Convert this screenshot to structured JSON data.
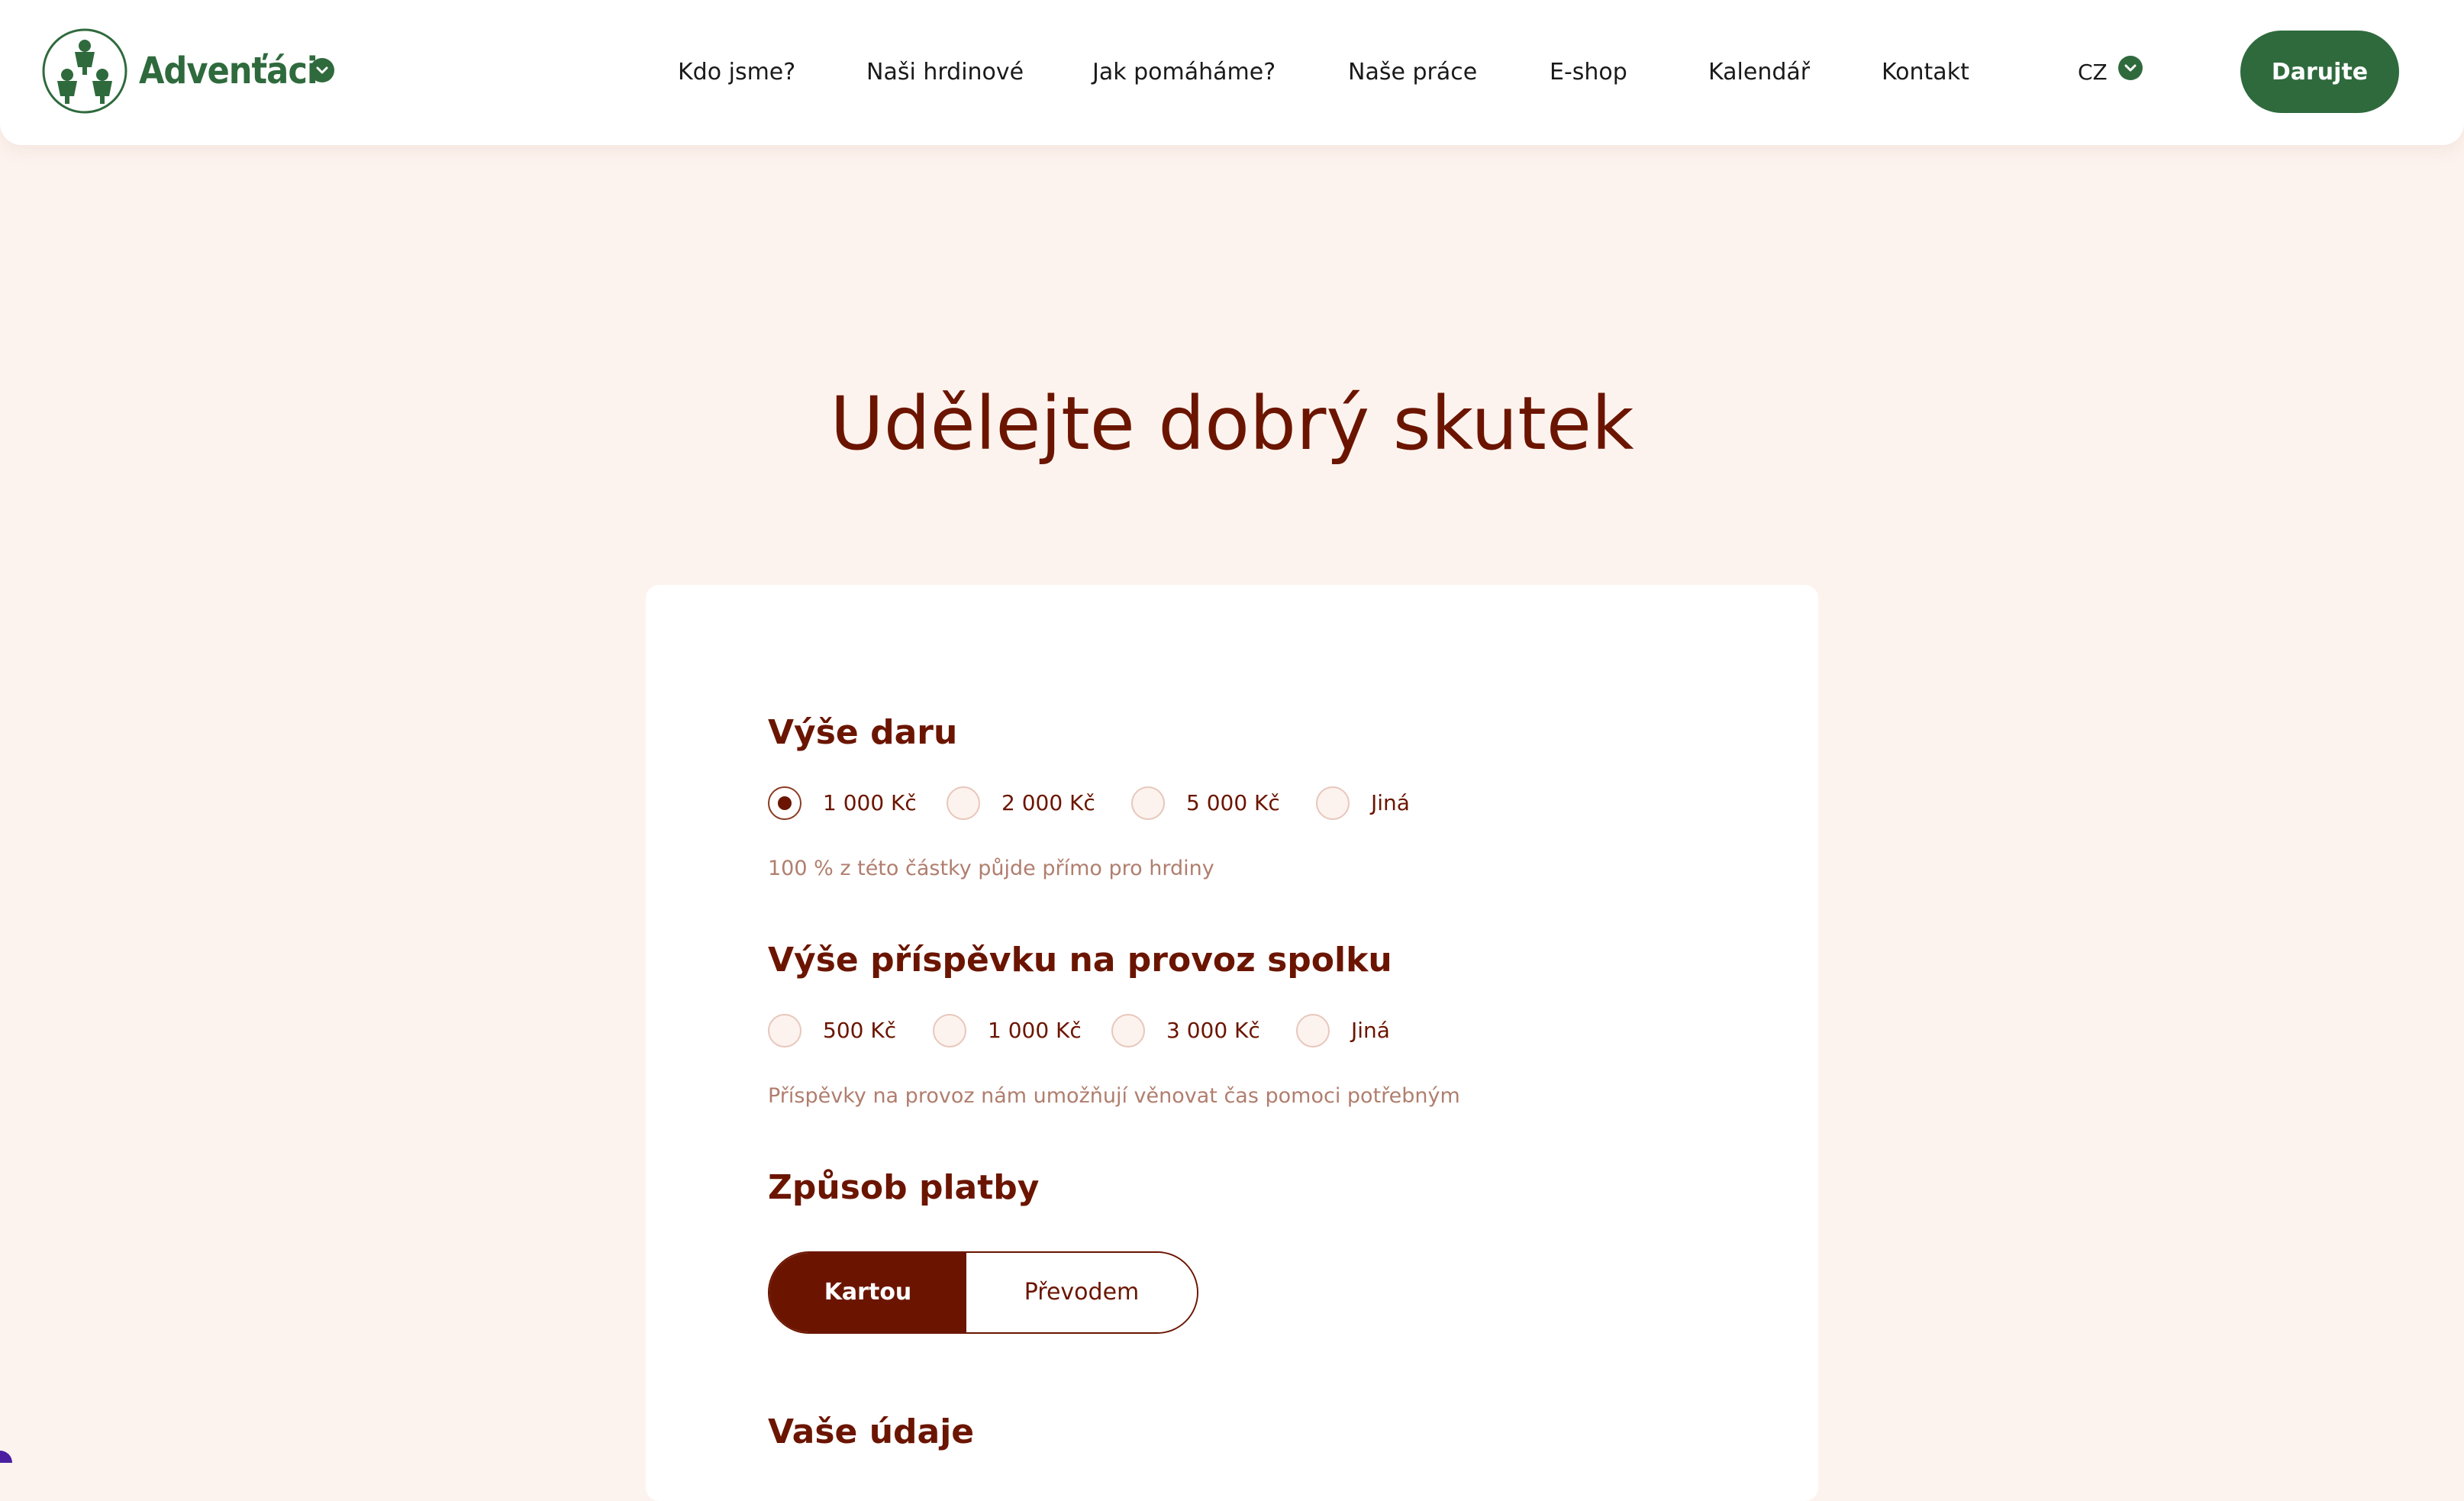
{
  "brand": {
    "name": "Advenťáci"
  },
  "nav": {
    "items": [
      "Kdo jsme?",
      "Naši hrdinové",
      "Jak pomáháme?",
      "Naše práce",
      "E-shop",
      "Kalendář",
      "Kontakt"
    ],
    "language": "CZ",
    "donate_label": "Darujte"
  },
  "page": {
    "title": "Udělejte dobrý skutek"
  },
  "donation": {
    "title": "Výše daru",
    "options": [
      "1 000 Kč",
      "2 000 Kč",
      "5 000 Kč",
      "Jiná"
    ],
    "selected": "1 000 Kč",
    "hint": "100 % z této částky půjde přímo pro hrdiny"
  },
  "contribution": {
    "title": "Výše příspěvku na provoz spolku",
    "options": [
      "500 Kč",
      "1 000 Kč",
      "3 000 Kč",
      "Jiná"
    ],
    "selected": null,
    "hint": "Příspěvky na provoz nám umožňují věnovat čas pomoci potřebným"
  },
  "payment": {
    "title": "Způsob platby",
    "options": [
      "Kartou",
      "Převodem"
    ],
    "selected": "Kartou"
  },
  "details": {
    "title": "Vaše údaje"
  },
  "colors": {
    "primary_green": "#2f6a3d",
    "accent_brown": "#6b1500",
    "page_bg": "#fdf3ee",
    "hint_text": "#b07e6e"
  },
  "icons": {
    "logo": "three-children-logo-icon",
    "brand_dropdown": "chevron-down-icon",
    "language_dropdown": "chevron-down-icon"
  }
}
